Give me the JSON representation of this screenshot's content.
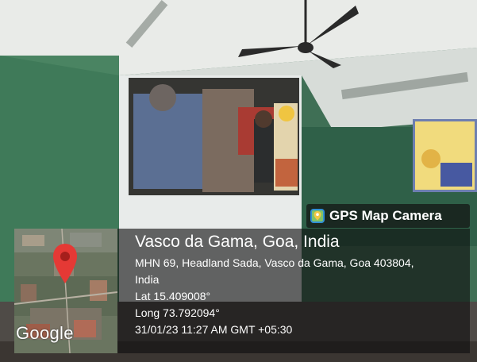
{
  "badge": {
    "text": "GPS Map Camera",
    "icon": "map-pin-camera-icon"
  },
  "location": {
    "title": "Vasco da Gama, Goa, India",
    "address_line1": "MHN 69, Headland Sada, Vasco da Gama, Goa 403804,",
    "address_line2": "India",
    "lat": "Lat 15.409008°",
    "long": "Long 73.792094°",
    "datetime": "31/01/23 11:27 AM GMT +05:30"
  },
  "map": {
    "watermark": "Google",
    "pin_color": "#e53935"
  }
}
